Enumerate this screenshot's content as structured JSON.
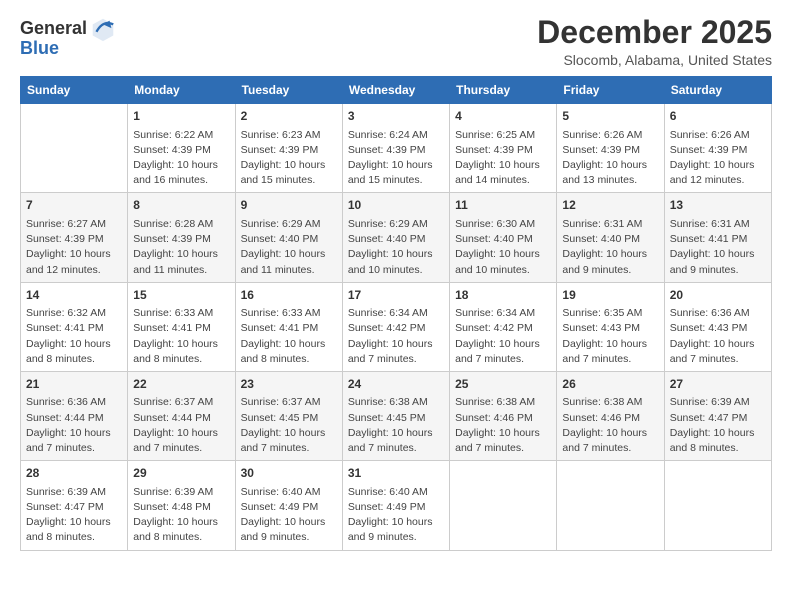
{
  "logo": {
    "line1": "General",
    "line2": "Blue"
  },
  "title": "December 2025",
  "location": "Slocomb, Alabama, United States",
  "days_of_week": [
    "Sunday",
    "Monday",
    "Tuesday",
    "Wednesday",
    "Thursday",
    "Friday",
    "Saturday"
  ],
  "weeks": [
    [
      {
        "day": "",
        "info": ""
      },
      {
        "day": "1",
        "info": "Sunrise: 6:22 AM\nSunset: 4:39 PM\nDaylight: 10 hours\nand 16 minutes."
      },
      {
        "day": "2",
        "info": "Sunrise: 6:23 AM\nSunset: 4:39 PM\nDaylight: 10 hours\nand 15 minutes."
      },
      {
        "day": "3",
        "info": "Sunrise: 6:24 AM\nSunset: 4:39 PM\nDaylight: 10 hours\nand 15 minutes."
      },
      {
        "day": "4",
        "info": "Sunrise: 6:25 AM\nSunset: 4:39 PM\nDaylight: 10 hours\nand 14 minutes."
      },
      {
        "day": "5",
        "info": "Sunrise: 6:26 AM\nSunset: 4:39 PM\nDaylight: 10 hours\nand 13 minutes."
      },
      {
        "day": "6",
        "info": "Sunrise: 6:26 AM\nSunset: 4:39 PM\nDaylight: 10 hours\nand 12 minutes."
      }
    ],
    [
      {
        "day": "7",
        "info": "Sunrise: 6:27 AM\nSunset: 4:39 PM\nDaylight: 10 hours\nand 12 minutes."
      },
      {
        "day": "8",
        "info": "Sunrise: 6:28 AM\nSunset: 4:39 PM\nDaylight: 10 hours\nand 11 minutes."
      },
      {
        "day": "9",
        "info": "Sunrise: 6:29 AM\nSunset: 4:40 PM\nDaylight: 10 hours\nand 11 minutes."
      },
      {
        "day": "10",
        "info": "Sunrise: 6:29 AM\nSunset: 4:40 PM\nDaylight: 10 hours\nand 10 minutes."
      },
      {
        "day": "11",
        "info": "Sunrise: 6:30 AM\nSunset: 4:40 PM\nDaylight: 10 hours\nand 10 minutes."
      },
      {
        "day": "12",
        "info": "Sunrise: 6:31 AM\nSunset: 4:40 PM\nDaylight: 10 hours\nand 9 minutes."
      },
      {
        "day": "13",
        "info": "Sunrise: 6:31 AM\nSunset: 4:41 PM\nDaylight: 10 hours\nand 9 minutes."
      }
    ],
    [
      {
        "day": "14",
        "info": "Sunrise: 6:32 AM\nSunset: 4:41 PM\nDaylight: 10 hours\nand 8 minutes."
      },
      {
        "day": "15",
        "info": "Sunrise: 6:33 AM\nSunset: 4:41 PM\nDaylight: 10 hours\nand 8 minutes."
      },
      {
        "day": "16",
        "info": "Sunrise: 6:33 AM\nSunset: 4:41 PM\nDaylight: 10 hours\nand 8 minutes."
      },
      {
        "day": "17",
        "info": "Sunrise: 6:34 AM\nSunset: 4:42 PM\nDaylight: 10 hours\nand 7 minutes."
      },
      {
        "day": "18",
        "info": "Sunrise: 6:34 AM\nSunset: 4:42 PM\nDaylight: 10 hours\nand 7 minutes."
      },
      {
        "day": "19",
        "info": "Sunrise: 6:35 AM\nSunset: 4:43 PM\nDaylight: 10 hours\nand 7 minutes."
      },
      {
        "day": "20",
        "info": "Sunrise: 6:36 AM\nSunset: 4:43 PM\nDaylight: 10 hours\nand 7 minutes."
      }
    ],
    [
      {
        "day": "21",
        "info": "Sunrise: 6:36 AM\nSunset: 4:44 PM\nDaylight: 10 hours\nand 7 minutes."
      },
      {
        "day": "22",
        "info": "Sunrise: 6:37 AM\nSunset: 4:44 PM\nDaylight: 10 hours\nand 7 minutes."
      },
      {
        "day": "23",
        "info": "Sunrise: 6:37 AM\nSunset: 4:45 PM\nDaylight: 10 hours\nand 7 minutes."
      },
      {
        "day": "24",
        "info": "Sunrise: 6:38 AM\nSunset: 4:45 PM\nDaylight: 10 hours\nand 7 minutes."
      },
      {
        "day": "25",
        "info": "Sunrise: 6:38 AM\nSunset: 4:46 PM\nDaylight: 10 hours\nand 7 minutes."
      },
      {
        "day": "26",
        "info": "Sunrise: 6:38 AM\nSunset: 4:46 PM\nDaylight: 10 hours\nand 7 minutes."
      },
      {
        "day": "27",
        "info": "Sunrise: 6:39 AM\nSunset: 4:47 PM\nDaylight: 10 hours\nand 8 minutes."
      }
    ],
    [
      {
        "day": "28",
        "info": "Sunrise: 6:39 AM\nSunset: 4:47 PM\nDaylight: 10 hours\nand 8 minutes."
      },
      {
        "day": "29",
        "info": "Sunrise: 6:39 AM\nSunset: 4:48 PM\nDaylight: 10 hours\nand 8 minutes."
      },
      {
        "day": "30",
        "info": "Sunrise: 6:40 AM\nSunset: 4:49 PM\nDaylight: 10 hours\nand 9 minutes."
      },
      {
        "day": "31",
        "info": "Sunrise: 6:40 AM\nSunset: 4:49 PM\nDaylight: 10 hours\nand 9 minutes."
      },
      {
        "day": "",
        "info": ""
      },
      {
        "day": "",
        "info": ""
      },
      {
        "day": "",
        "info": ""
      }
    ]
  ]
}
